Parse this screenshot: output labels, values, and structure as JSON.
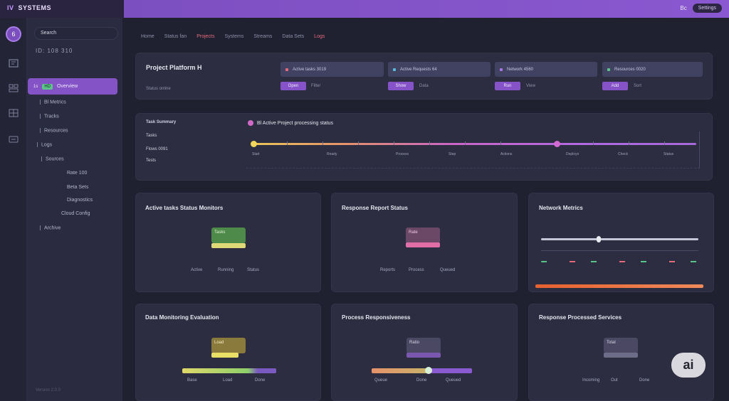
{
  "topbar": {
    "brand_mark": "IV",
    "brand": "SYSTEMS",
    "right_label": "Bc",
    "right_chip": "Settings"
  },
  "rail": {
    "logo": "6"
  },
  "nav": {
    "search_value": "Search",
    "subtitle": "ID: 108 310",
    "active_prefix": "1s",
    "active_tag": "HD",
    "active_label": "Overview",
    "items": [
      "Bl Metrics",
      "Tracks",
      "Resources",
      "Logs",
      "Sources",
      "Rate 100",
      "Beta Sets",
      "Diagnostics",
      "Cloud Config",
      "Archive"
    ],
    "footer": "Version 2.0.0"
  },
  "tabs": [
    "Home",
    "Status fan",
    "Projects",
    "Systems",
    "Streams",
    "Data Sets",
    "Logs"
  ],
  "summary": {
    "title": "Project Platform H",
    "subtitle": "Status online",
    "stats": [
      {
        "label": "Active tasks 3019",
        "color": "#e56b7a"
      },
      {
        "label": "Active Requests 64",
        "color": "#5bb8d6"
      },
      {
        "label": "Network 4560",
        "color": "#a278e4"
      },
      {
        "label": "Resources 0020",
        "color": "#5cc48a"
      }
    ],
    "pills": [
      "Open",
      "Show",
      "Run",
      "Add"
    ],
    "pill_texts": [
      "Filter",
      "Data",
      "View",
      "Sort"
    ]
  },
  "timeline": {
    "labels": [
      "Task Summary",
      "Tasks",
      "Flows 0091",
      "Tests"
    ],
    "legend": "Bl Active Project processing status",
    "ticks": [
      "Start",
      "Ready",
      "Process",
      "Step",
      "Actions",
      "Deploys",
      "Check",
      "Status"
    ]
  },
  "widgets": [
    {
      "title": "Active tasks Status Monitors",
      "box_label": "Tasks",
      "labels": [
        "Active",
        "Running",
        "Status"
      ]
    },
    {
      "title": "Response Report Status",
      "box_label": "Rate",
      "labels": [
        "Reports",
        "Process",
        "Queued"
      ]
    },
    {
      "title": "Network Metrics",
      "labels": []
    },
    {
      "title": "Data Monitoring Evaluation",
      "box_label": "Load",
      "labels": [
        "Base",
        "Load",
        "Done"
      ]
    },
    {
      "title": "Process Responsiveness",
      "box_label": "Ratio",
      "labels": [
        "Queue",
        "Done",
        "Queued"
      ]
    },
    {
      "title": "Response Processed Services",
      "box_label": "Total",
      "labels": [
        "Incoming",
        "Out",
        "Done"
      ]
    }
  ],
  "ai_badge": "ai"
}
